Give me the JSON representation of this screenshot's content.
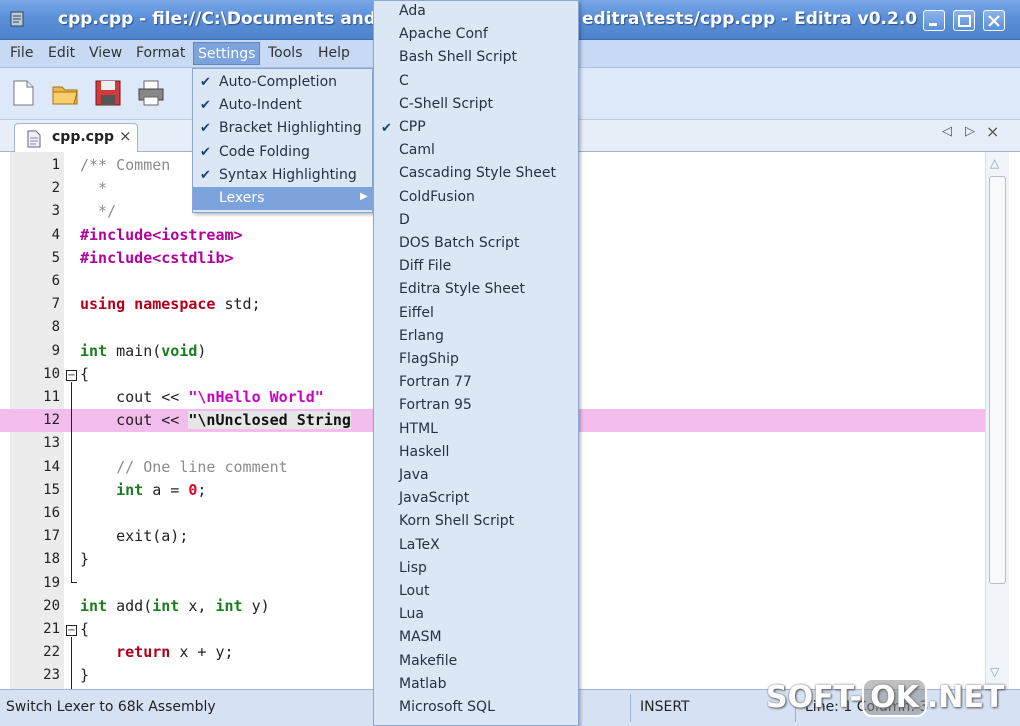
{
  "window": {
    "title_left": "cpp.cpp - file://C:\\Documents and Se",
    "title_right": "editra\\tests/cpp.cpp - Editra v0.2.0"
  },
  "menubar": [
    "File",
    "Edit",
    "View",
    "Format",
    "Settings",
    "Tools",
    "Help"
  ],
  "settings_menu": {
    "items": [
      {
        "label": "Auto-Completion",
        "checked": true
      },
      {
        "label": "Auto-Indent",
        "checked": true
      },
      {
        "label": "Bracket Highlighting",
        "checked": true
      },
      {
        "label": "Code Folding",
        "checked": true
      },
      {
        "label": "Syntax Highlighting",
        "checked": true
      },
      {
        "label": "Lexers",
        "checked": false,
        "submenu": true
      }
    ]
  },
  "lexers_menu": {
    "checked": "CPP",
    "items": [
      "Ada",
      "Apache Conf",
      "Bash Shell Script",
      "C",
      "C-Shell Script",
      "CPP",
      "Caml",
      "Cascading Style Sheet",
      "ColdFusion",
      "D",
      "DOS Batch Script",
      "Diff File",
      "Editra Style Sheet",
      "Eiffel",
      "Erlang",
      "FlagShip",
      "Fortran 77",
      "Fortran 95",
      "HTML",
      "Haskell",
      "Java",
      "JavaScript",
      "Korn Shell Script",
      "LaTeX",
      "Lisp",
      "Lout",
      "Lua",
      "MASM",
      "Makefile",
      "Matlab",
      "Microsoft SQL"
    ]
  },
  "tab": {
    "label": "cpp.cpp",
    "close": "×"
  },
  "tab_nav": {
    "prev": "◁",
    "next": "▷",
    "close": "×"
  },
  "code": {
    "line_numbers": [
      "1",
      "2",
      "3",
      "4",
      "5",
      "6",
      "7",
      "8",
      "9",
      "10",
      "11",
      "12",
      "13",
      "14",
      "15",
      "16",
      "17",
      "18",
      "19",
      "20",
      "21",
      "22",
      "23"
    ],
    "lines": [
      [
        {
          "t": "/** Commen",
          "c": "cm"
        }
      ],
      [
        {
          "t": "  *",
          "c": "cm"
        }
      ],
      [
        {
          "t": "  */",
          "c": "cm"
        }
      ],
      [
        {
          "t": "#include<iostream>",
          "c": "pp"
        }
      ],
      [
        {
          "t": "#include<cstdlib>",
          "c": "pp"
        }
      ],
      [],
      [
        {
          "t": "using namespace",
          "c": "kw2"
        },
        {
          "t": " std;",
          "c": ""
        }
      ],
      [],
      [
        {
          "t": "int",
          "c": "kw"
        },
        {
          "t": " main(",
          "c": ""
        },
        {
          "t": "void",
          "c": "kw"
        },
        {
          "t": ")",
          "c": ""
        }
      ],
      [
        {
          "t": "{",
          "c": ""
        }
      ],
      [
        {
          "t": "    cout << ",
          "c": ""
        },
        {
          "t": "\"\\nHello World\"",
          "c": "str"
        }
      ],
      [
        {
          "t": "    cout << ",
          "c": ""
        },
        {
          "t": "\"\\nUnclosed String",
          "c": "unclosed-str"
        }
      ],
      [],
      [
        {
          "t": "    // One line comment",
          "c": "cm"
        }
      ],
      [
        {
          "t": "    ",
          "c": ""
        },
        {
          "t": "int",
          "c": "kw"
        },
        {
          "t": " a = ",
          "c": ""
        },
        {
          "t": "0",
          "c": "num"
        },
        {
          "t": ";",
          "c": ""
        }
      ],
      [],
      [
        {
          "t": "    exit(a);",
          "c": ""
        }
      ],
      [
        {
          "t": "}",
          "c": ""
        }
      ],
      [],
      [
        {
          "t": "int",
          "c": "kw"
        },
        {
          "t": " add(",
          "c": ""
        },
        {
          "t": "int",
          "c": "kw"
        },
        {
          "t": " x, ",
          "c": ""
        },
        {
          "t": "int",
          "c": "kw"
        },
        {
          "t": " y)",
          "c": ""
        }
      ],
      [
        {
          "t": "{",
          "c": ""
        }
      ],
      [
        {
          "t": "    ",
          "c": ""
        },
        {
          "t": "return",
          "c": "kw2"
        },
        {
          "t": " x + y;",
          "c": ""
        }
      ],
      [
        {
          "t": "}",
          "c": ""
        }
      ]
    ]
  },
  "statusbar": {
    "message": "Switch Lexer to 68k Assembly",
    "mode": "INSERT",
    "position": "Line: 1  Column: 3"
  },
  "watermark": {
    "left": "SOFT-",
    "box": "OK",
    "right": ".NET"
  }
}
